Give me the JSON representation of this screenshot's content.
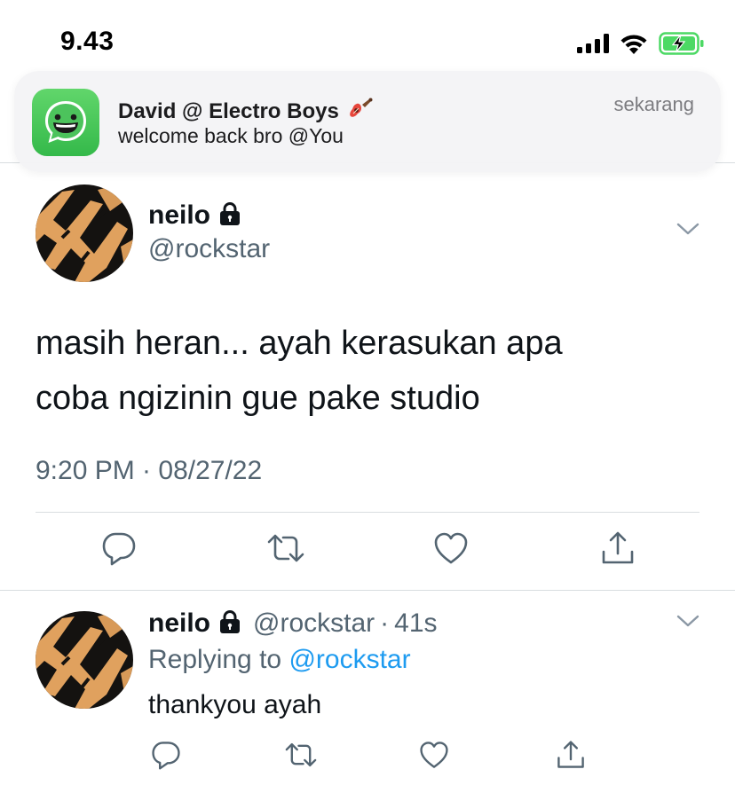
{
  "status_bar": {
    "time": "9.43",
    "icons": [
      "cellular-signal-icon",
      "wifi-icon",
      "battery-charging-icon"
    ],
    "battery_color": "#4cd964"
  },
  "notification": {
    "app_icon": "whatsapp-icon",
    "title": "David @ Electro Boys",
    "title_emoji": "guitar-icon",
    "body": "welcome back bro @You",
    "time": "sekarang"
  },
  "tweet": {
    "name": "neilo",
    "protected_icon": "lock-icon",
    "handle": "@rockstar",
    "text_line1": "masih heran... ayah kerasukan apa",
    "text_line2": "coba ngizinin gue pake studio",
    "timestamp": "9:20 PM · 08/27/22",
    "actions": [
      "reply-icon",
      "retweet-icon",
      "like-icon",
      "share-icon"
    ]
  },
  "reply": {
    "name": "neilo",
    "handle": "@rockstar",
    "separator": "·",
    "age": "41s",
    "replying_prefix": "Replying to",
    "replying_to": "@rockstar",
    "text": "thankyou ayah",
    "actions": [
      "reply-icon",
      "retweet-icon",
      "like-icon",
      "share-icon"
    ]
  },
  "colors": {
    "text": "#0f1419",
    "secondary": "#536471",
    "link": "#1d9bf0",
    "whatsapp_green": "#3fc453",
    "avatar_orange": "#e0a15e"
  }
}
